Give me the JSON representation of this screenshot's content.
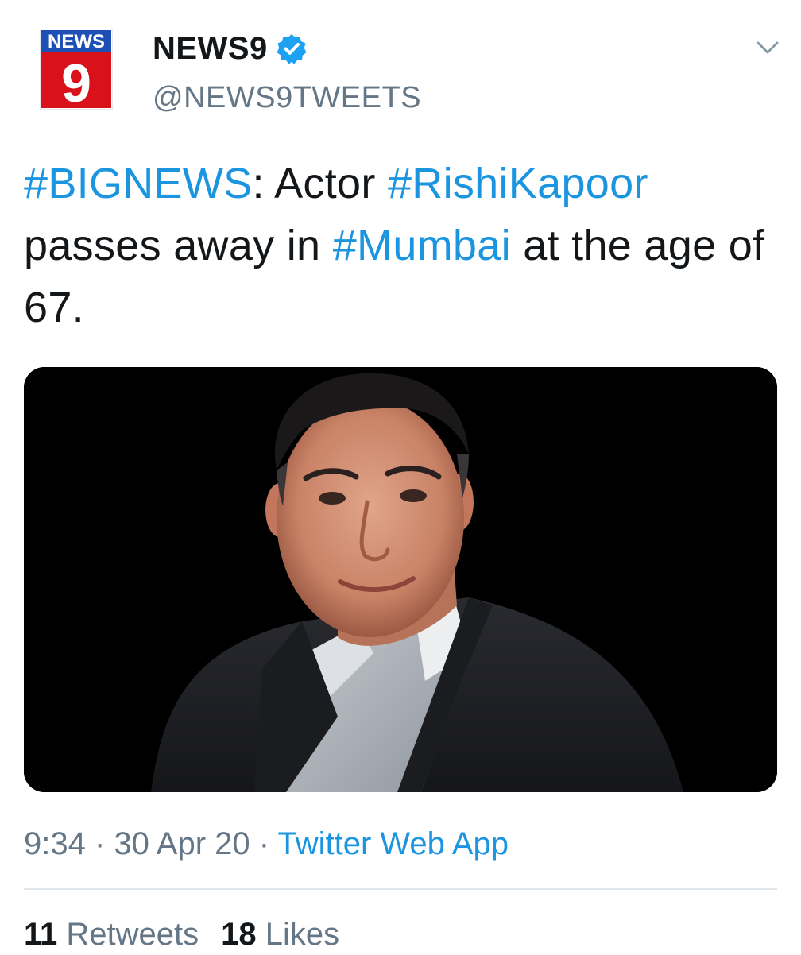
{
  "author": {
    "avatar_logo_text": "NEWS",
    "avatar_logo_number": "9",
    "display_name": "NEWS9",
    "handle": "@NEWS9TWEETS",
    "verified_icon": "verified-badge-icon",
    "menu_icon": "chevron-down-icon"
  },
  "tweet": {
    "text_parts": [
      {
        "text": "#BIGNEWS",
        "hashtag": true
      },
      {
        "text": ": Actor ",
        "hashtag": false
      },
      {
        "text": "#RishiKapoor",
        "hashtag": true
      },
      {
        "text": " passes away in ",
        "hashtag": false
      },
      {
        "text": "#Mumbai",
        "hashtag": true
      },
      {
        "text": " at the age of 67.",
        "hashtag": false
      }
    ],
    "media_description_icon": "photo-portrait"
  },
  "meta": {
    "time": "9:34",
    "separator": " · ",
    "date": "30 Apr 20",
    "source": "Twitter Web App"
  },
  "stats": {
    "retweets_count": "11",
    "retweets_label": "Retweets",
    "likes_count": "18",
    "likes_label": "Likes"
  },
  "colors": {
    "link": "#1b95e0",
    "text": "#14171a",
    "secondary": "#657786",
    "logo_red": "#d9111b",
    "logo_blue": "#1d4fb5"
  }
}
